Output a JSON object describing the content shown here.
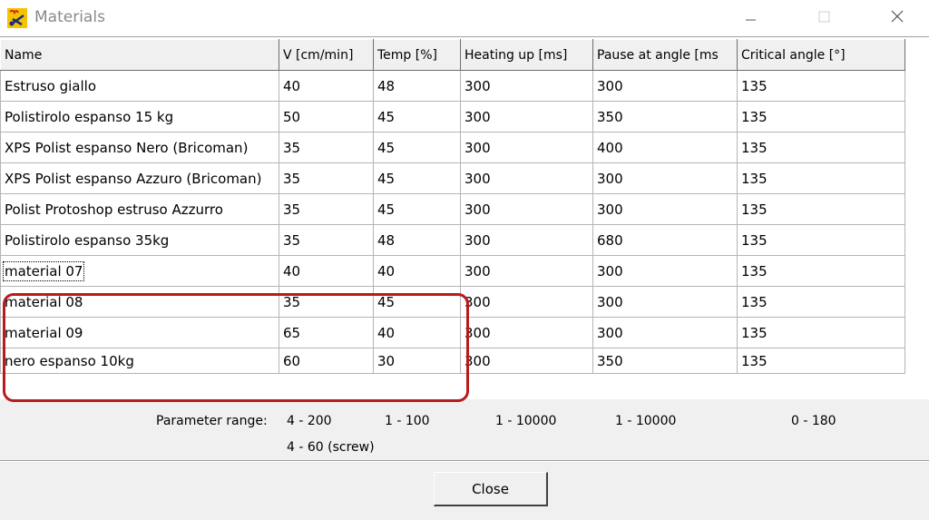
{
  "window": {
    "title": "Materials",
    "icon": "materials-app-icon",
    "controls": [
      "minimize-icon",
      "maximize-icon",
      "close-icon"
    ]
  },
  "table": {
    "columns": [
      "Name",
      "V [cm/min]",
      "Temp [%]",
      "Heating up [ms]",
      "Pause at angle [ms",
      "Critical angle [°]"
    ],
    "rows": [
      [
        "Estruso giallo",
        "40",
        "48",
        "300",
        "300",
        "135"
      ],
      [
        "Polistirolo espanso 15 kg",
        "50",
        "45",
        "300",
        "350",
        "135"
      ],
      [
        "XPS Polist espanso Nero (Bricoman)",
        "35",
        "45",
        "300",
        "400",
        "135"
      ],
      [
        "XPS Polist espanso Azzuro (Bricoman)",
        "35",
        "45",
        "300",
        "300",
        "135"
      ],
      [
        "Polist Protoshop estruso Azzurro",
        "35",
        "45",
        "300",
        "300",
        "135"
      ],
      [
        "Polistirolo espanso 35kg",
        "35",
        "48",
        "300",
        "680",
        "135"
      ],
      [
        "material 07",
        "40",
        "40",
        "300",
        "300",
        "135"
      ],
      [
        "material 08",
        "35",
        "45",
        "300",
        "300",
        "135"
      ],
      [
        "material 09",
        "65",
        "40",
        "300",
        "300",
        "135"
      ],
      [
        "nero espanso 10kg",
        "60",
        "30",
        "300",
        "350",
        "135"
      ]
    ],
    "focused_row": 6,
    "highlight_color": "#b71c1c"
  },
  "parameter_range": {
    "label": "Parameter range:",
    "speed": "4 - 200",
    "speed_screw": "4 - 60 (screw)",
    "temp": "1 - 100",
    "heating": "1 - 10000",
    "pause": "1 - 10000",
    "angle": "0 - 180"
  },
  "buttons": {
    "close_label": "Close"
  }
}
